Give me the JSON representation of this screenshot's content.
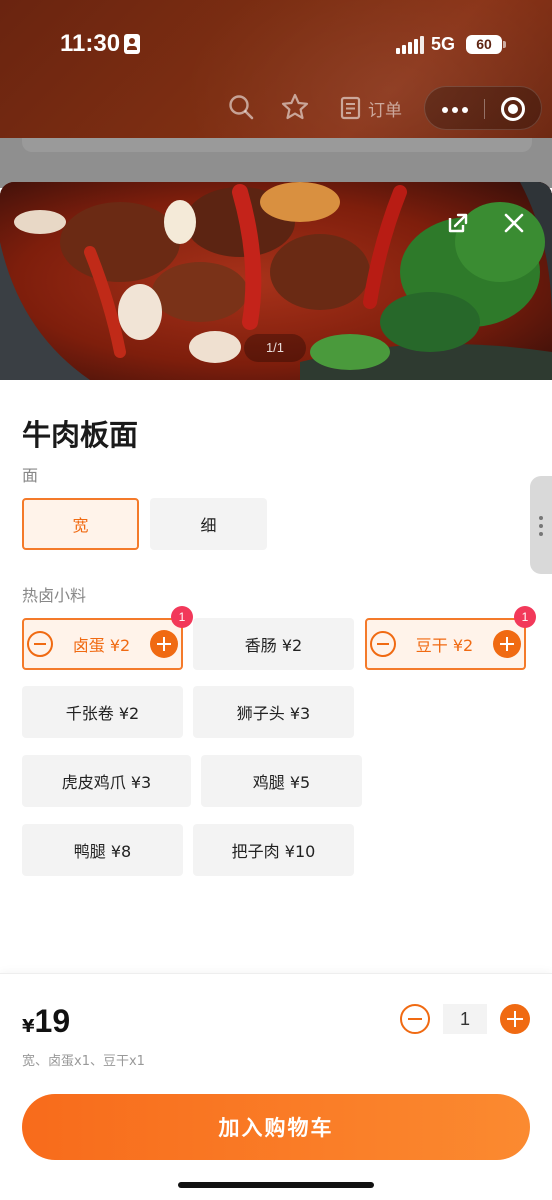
{
  "status_bar": {
    "time": "11:30",
    "network": "5G",
    "battery": "60"
  },
  "nav": {
    "orders_label": "订单"
  },
  "gallery": {
    "pager": "1/1"
  },
  "dish": {
    "name": "牛肉板面"
  },
  "noodle_group": {
    "label": "面",
    "options": [
      {
        "label": "宽",
        "selected": true
      },
      {
        "label": "细",
        "selected": false
      }
    ]
  },
  "topping_group": {
    "label": "热卤小料",
    "options": [
      {
        "label": "卤蛋 ¥2",
        "selected": true,
        "count": "1"
      },
      {
        "label": "香肠 ¥2",
        "selected": false
      },
      {
        "label": "豆干 ¥2",
        "selected": true,
        "count": "1"
      },
      {
        "label": "千张卷 ¥2",
        "selected": false
      },
      {
        "label": "狮子头 ¥3",
        "selected": false
      },
      {
        "label": "虎皮鸡爪 ¥3",
        "selected": false
      },
      {
        "label": "鸡腿 ¥5",
        "selected": false
      },
      {
        "label": "鸭腿 ¥8",
        "selected": false
      },
      {
        "label": "把子肉 ¥10",
        "selected": false
      }
    ]
  },
  "cart_bar": {
    "currency": "¥",
    "price": "19",
    "summary": "宽、卤蛋x1、豆干x1",
    "quantity": "1",
    "add_button_label": "加入购物车"
  },
  "colors": {
    "accent": "#f06a12",
    "header_bg": "#7a2d12",
    "badge": "#f2395a",
    "selected_bg": "#fff3ea"
  }
}
